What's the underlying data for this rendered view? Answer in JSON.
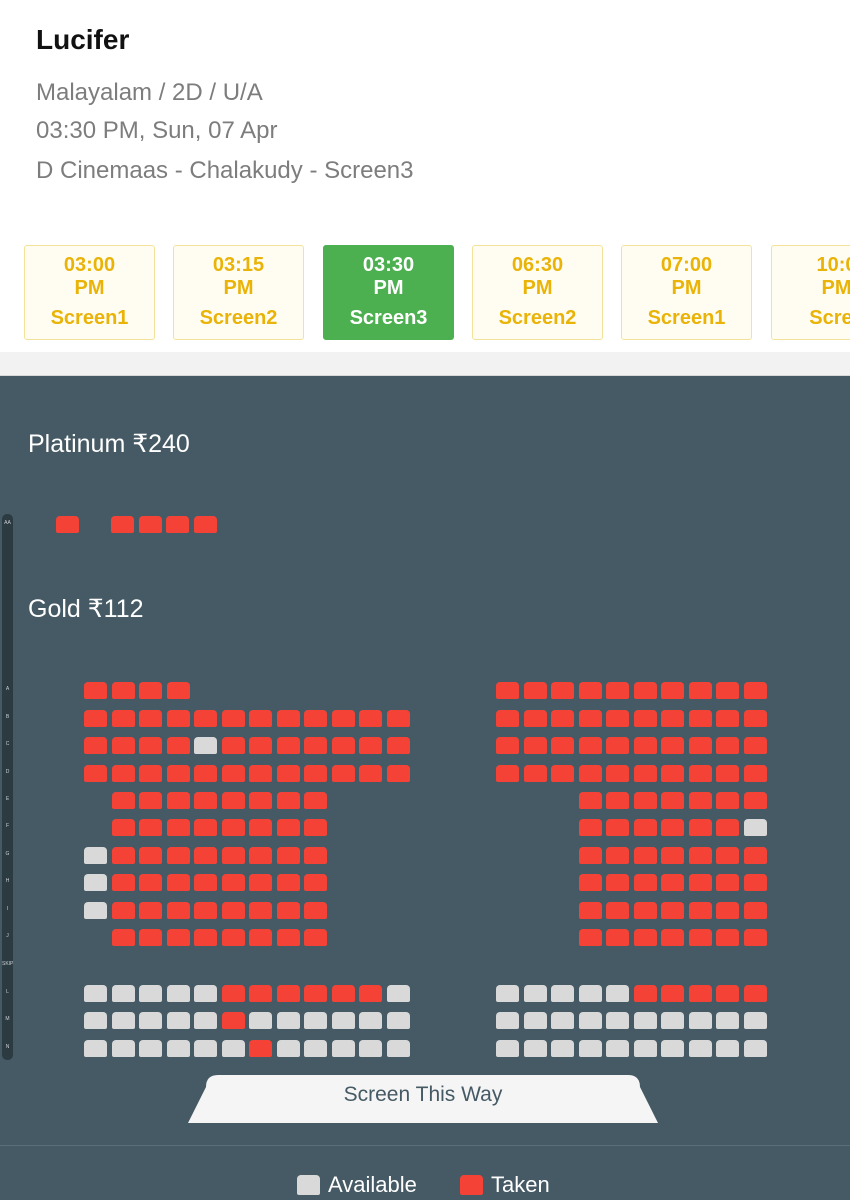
{
  "movie": {
    "title": "Lucifer",
    "format": "Malayalam / 2D / U/A",
    "datetime": "03:30 PM, Sun, 07 Apr",
    "venue": "D Cinemaas - Chalakudy - Screen3"
  },
  "showtimes": [
    {
      "time": "03:00",
      "period": "PM",
      "screen": "Screen1",
      "selected": false
    },
    {
      "time": "03:15",
      "period": "PM",
      "screen": "Screen2",
      "selected": false
    },
    {
      "time": "03:30",
      "period": "PM",
      "screen": "Screen3",
      "selected": true
    },
    {
      "time": "06:30",
      "period": "PM",
      "screen": "Screen2",
      "selected": false
    },
    {
      "time": "07:00",
      "period": "PM",
      "screen": "Screen1",
      "selected": false
    },
    {
      "time": "10:0",
      "period": "PM",
      "screen": "Scree",
      "selected": false
    }
  ],
  "categories": [
    {
      "name": "Platinum ₹240"
    },
    {
      "name": "Gold ₹112"
    }
  ],
  "row_labels": [
    "AA",
    "A",
    "B",
    "C",
    "D",
    "E",
    "F",
    "G",
    "H",
    "I",
    "J",
    "SKIP",
    "L",
    "M",
    "N"
  ],
  "seat_map": {
    "legend": "T = taken, A = available, - = no seat; left block 12 columns, right block 10 columns",
    "platinum": {
      "AA": "T-TTTT"
    },
    "gold_left": {
      "A": "TTTT--------",
      "B": "TTTTTTTTTTTT",
      "C": "TTTTATTTTTTT",
      "D": "TTTTTTTTTTTT",
      "E": "-TTTTTTTT---",
      "F": "-TTTTTTTT---",
      "G": "ATTTTTTTT---",
      "H": "ATTTTTTTT---",
      "I": "ATTTTTTTT---",
      "J": "-TTTTTTTT---",
      "L": "AAAAATTTTTTA",
      "M": "AAAAATAAAAAA",
      "N": "AAAAAATAAAAA"
    },
    "gold_right": {
      "A": "TTTTTTTTTT",
      "B": "TTTTTTTTTT",
      "C": "TTTTTTTTTT",
      "D": "TTTTTTTTTT",
      "E": "---TTTTTTT",
      "F": "---TTTTTTA",
      "G": "---TTTTTTT",
      "H": "---TTTTTTT",
      "I": "---TTTTTTT",
      "J": "---TTTTTTT",
      "L": "AAAAATTTTT",
      "M": "AAAAAAAAAA",
      "N": "AAAAAAAAAA"
    }
  },
  "screen_label": "Screen This Way",
  "legend": {
    "available": "Available",
    "taken": "Taken"
  },
  "colors": {
    "taken": "#f44336",
    "available": "#d9d9d9",
    "selected_showtime": "#4caf50",
    "showtime_text": "#eab308",
    "background": "#455a64"
  }
}
